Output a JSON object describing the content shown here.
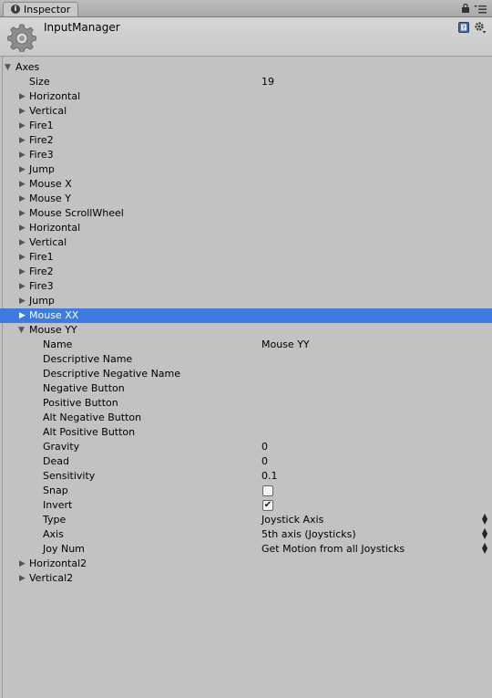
{
  "tab": {
    "title": "Inspector"
  },
  "header": {
    "title": "InputManager"
  },
  "axes": {
    "label": "Axes",
    "size_label": "Size",
    "size_value": "19",
    "items": [
      "Horizontal",
      "Vertical",
      "Fire1",
      "Fire2",
      "Fire3",
      "Jump",
      "Mouse X",
      "Mouse Y",
      "Mouse ScrollWheel",
      "Horizontal",
      "Vertical",
      "Fire1",
      "Fire2",
      "Fire3",
      "Jump",
      "Mouse XX"
    ],
    "expanded": {
      "label": "Mouse YY",
      "fields": {
        "name_label": "Name",
        "name_value": "Mouse YY",
        "desc_label": "Descriptive Name",
        "desc_neg_label": "Descriptive Negative Name",
        "neg_button_label": "Negative Button",
        "pos_button_label": "Positive Button",
        "alt_neg_label": "Alt Negative Button",
        "alt_pos_label": "Alt Positive Button",
        "gravity_label": "Gravity",
        "gravity_value": "0",
        "dead_label": "Dead",
        "dead_value": "0",
        "sensitivity_label": "Sensitivity",
        "sensitivity_value": "0.1",
        "snap_label": "Snap",
        "snap_checked": false,
        "invert_label": "Invert",
        "invert_checked": true,
        "type_label": "Type",
        "type_value": "Joystick Axis",
        "axis_label": "Axis",
        "axis_value": "5th axis (Joysticks)",
        "joynum_label": "Joy Num",
        "joynum_value": "Get Motion from all Joysticks"
      }
    },
    "after": [
      "Horizontal2",
      "Vertical2"
    ]
  },
  "colors": {
    "background": "#c2c2c2",
    "selected": "#3d7bdf"
  },
  "icons": {
    "tab": "info-icon",
    "lock": "lock-icon",
    "menu": "menu-icon",
    "asset": "gear-icon",
    "help": "help-icon",
    "settings": "settings-gear-icon"
  }
}
